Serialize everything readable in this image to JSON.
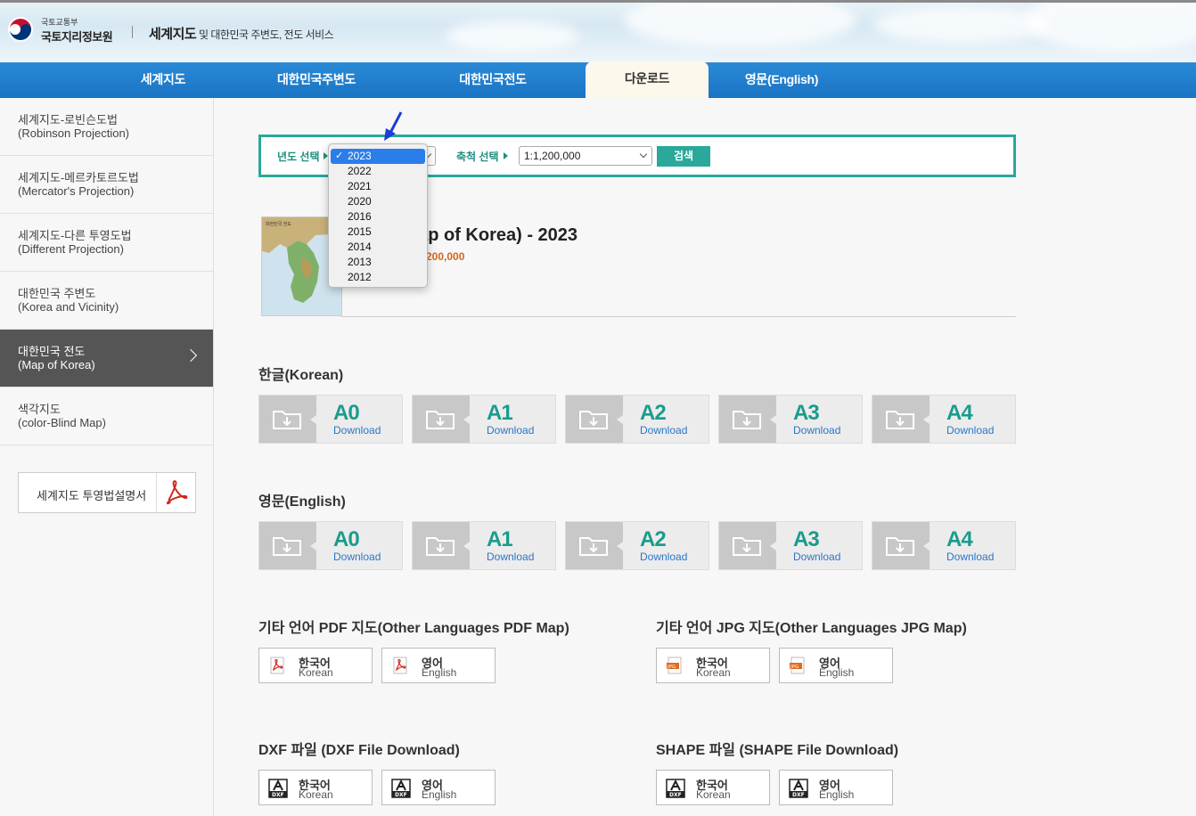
{
  "header": {
    "org_small": "국토교통부",
    "org_main": "국토지리정보원",
    "service_main": "세계지도",
    "service_sub": "및 대한민국 주변도, 전도 서비스"
  },
  "nav": {
    "items": [
      {
        "label": "세계지도"
      },
      {
        "label": "대한민국주변도"
      },
      {
        "label": "대한민국전도"
      },
      {
        "label": "다운로드",
        "active": true
      },
      {
        "label": "영문(English)"
      }
    ]
  },
  "sidebar": {
    "items": [
      {
        "line1": "세계지도-로빈슨도법",
        "line2": "(Robinson Projection)"
      },
      {
        "line1": "세계지도-메르카토르도법",
        "line2": "(Mercator's Projection)"
      },
      {
        "line1": "세계지도-다른 투영도법",
        "line2": "(Different Projection)"
      },
      {
        "line1": "대한민국 주변도",
        "line2": "(Korea and Vicinity)"
      },
      {
        "line1": "대한민국 전도",
        "line2": "(Map of Korea)",
        "active": true
      },
      {
        "line1": "색각지도",
        "line2": "(color-Blind Map)"
      }
    ],
    "pdf_guide_label": "세계지도 투영법설명서"
  },
  "search": {
    "year_label": "년도 선택",
    "scale_label": "축척 선택",
    "scale_value": "1:1,200,000",
    "button_label": "검색",
    "year_selected": "2023",
    "year_options": [
      "2023",
      "2022",
      "2021",
      "2020",
      "2016",
      "2015",
      "2014",
      "2013",
      "2012"
    ],
    "check_mark": "✓"
  },
  "map_info": {
    "title": "국 전도(Map of Korea) - 2023",
    "scale_text": "200,000",
    "thumb_caption": "대한민국 전도"
  },
  "korean_section": {
    "title": "한글(Korean)",
    "buttons": [
      {
        "size": "A0",
        "sub": "Download"
      },
      {
        "size": "A1",
        "sub": "Download"
      },
      {
        "size": "A2",
        "sub": "Download"
      },
      {
        "size": "A3",
        "sub": "Download"
      },
      {
        "size": "A4",
        "sub": "Download"
      }
    ]
  },
  "english_section": {
    "title": "영문(English)",
    "buttons": [
      {
        "size": "A0",
        "sub": "Download"
      },
      {
        "size": "A1",
        "sub": "Download"
      },
      {
        "size": "A2",
        "sub": "Download"
      },
      {
        "size": "A3",
        "sub": "Download"
      },
      {
        "size": "A4",
        "sub": "Download"
      }
    ]
  },
  "other_pdf": {
    "title": "기타 언어 PDF 지도(Other Languages PDF Map)",
    "buttons": [
      {
        "ko": "한국어",
        "en": "Korean"
      },
      {
        "ko": "영어",
        "en": "English"
      }
    ]
  },
  "other_jpg": {
    "title": "기타 언어 JPG 지도(Other Languages JPG Map)",
    "buttons": [
      {
        "ko": "한국어",
        "en": "Korean"
      },
      {
        "ko": "영어",
        "en": "English"
      }
    ]
  },
  "dxf": {
    "title": "DXF 파일 (DXF File Download)",
    "buttons": [
      {
        "ko": "한국어",
        "en": "Korean"
      },
      {
        "ko": "영어",
        "en": "English"
      }
    ]
  },
  "shape": {
    "title": "SHAPE 파일 (SHAPE File Download)",
    "buttons": [
      {
        "ko": "한국어",
        "en": "Korean"
      },
      {
        "ko": "영어",
        "en": "English"
      }
    ]
  },
  "icons": {
    "download_folder": "folder-download-icon",
    "pdf": "pdf-icon",
    "jpg": "jpg-icon",
    "dxf": "dxf-icon",
    "annotation_arrow": "blue-arrow-icon"
  },
  "colors": {
    "accent": "#2aa89a",
    "nav_blue": "#1a74c4",
    "link_blue": "#2a76c8",
    "scale_orange": "#d4661c"
  }
}
